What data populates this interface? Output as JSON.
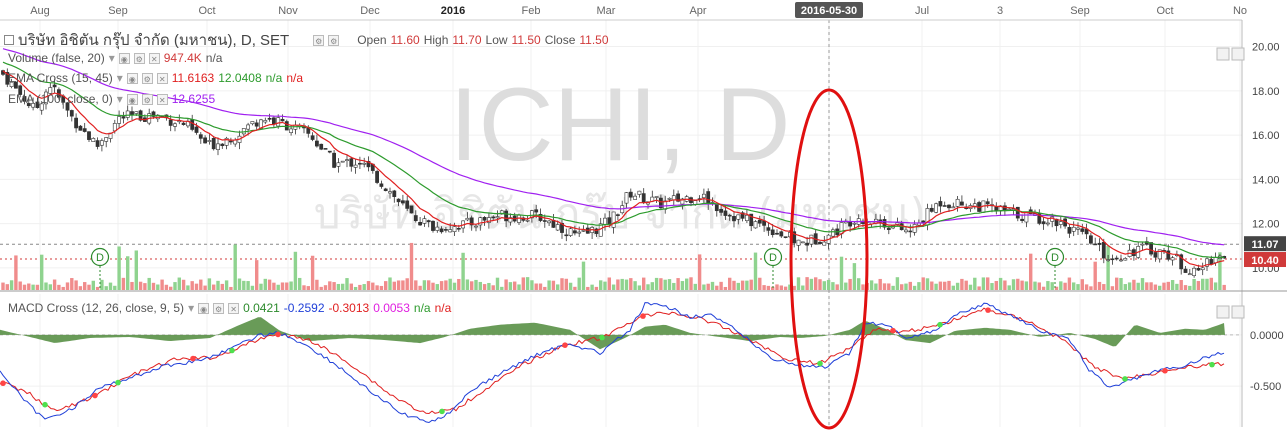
{
  "header": {
    "symbol": "บริษัท อิชิตัน กรุ๊ป จำกัด (มหาชน), D, SET",
    "ohlc": [
      {
        "label": "Open",
        "value": "11.60"
      },
      {
        "label": "High",
        "value": "11.70"
      },
      {
        "label": "Low",
        "value": "11.50"
      },
      {
        "label": "Close",
        "value": "11.50"
      }
    ],
    "watermark": "ICHI, D",
    "watermark_sub": "บริษัท อิชิตัน กรุ๊ป จำกัด (มหาชน)"
  },
  "indicators": {
    "volume": {
      "label": "Volume (false, 20)",
      "v1": "947.4K",
      "v2": "n/a"
    },
    "ema_cross": {
      "label": "EMA Cross (15, 45)",
      "v1": "11.6163",
      "v2": "12.0408",
      "v3": "n/a",
      "v4": "n/a"
    },
    "ema": {
      "label": "EMA (100, close, 0)",
      "v1": "12.6255"
    },
    "macd": {
      "label": "MACD Cross (12, 26, close, 9, 5)",
      "v1": "0.0421",
      "v2": "-0.2592",
      "v3": "-0.3013",
      "v4": "0.0053",
      "v5": "n/a",
      "v6": "n/a"
    }
  },
  "price_badges": {
    "upper": "11.07",
    "lower": "10.40"
  },
  "dividend_marker": "D",
  "crosshair_date": "2016-05-30",
  "colors": {
    "up": "#5aa55a",
    "down": "#c64545",
    "ema_fast": "#e02020",
    "ema_slow": "#2d9b2d",
    "ema100": "#a020f0",
    "macd_line": "#1f3fd8",
    "signal_line": "#e02020",
    "histogram": "#4f8a3b",
    "annotation": "#e01010",
    "badge_dark": "#444444",
    "badge_red": "#d03a3a"
  },
  "chart_data": [
    {
      "type": "candlestick",
      "title": "ICHI, D",
      "x_ticks": [
        "Aug",
        "Sep",
        "Oct",
        "Nov",
        "Dec",
        "2016",
        "Feb",
        "Mar",
        "Apr",
        "2016-05-30",
        "Jul",
        "3",
        "Sep",
        "Oct",
        "No"
      ],
      "ylim": [
        9.0,
        21.2
      ],
      "y_ticks": [
        "20.00",
        "18.00",
        "16.00",
        "14.00",
        "12.00",
        "10.00"
      ],
      "price_anchors": [
        {
          "x": 0,
          "close": 18.9
        },
        {
          "x": 35,
          "close": 17.1
        },
        {
          "x": 50,
          "close": 18.3
        },
        {
          "x": 70,
          "close": 16.9
        },
        {
          "x": 97,
          "close": 15.5
        },
        {
          "x": 120,
          "close": 16.8
        },
        {
          "x": 155,
          "close": 16.9
        },
        {
          "x": 185,
          "close": 16.5
        },
        {
          "x": 208,
          "close": 15.5
        },
        {
          "x": 235,
          "close": 16.0
        },
        {
          "x": 262,
          "close": 16.8
        },
        {
          "x": 285,
          "close": 16.5
        },
        {
          "x": 310,
          "close": 16.0
        },
        {
          "x": 335,
          "close": 14.7
        },
        {
          "x": 360,
          "close": 14.8
        },
        {
          "x": 385,
          "close": 13.7
        },
        {
          "x": 410,
          "close": 12.4
        },
        {
          "x": 435,
          "close": 11.8
        },
        {
          "x": 470,
          "close": 12.0
        },
        {
          "x": 500,
          "close": 12.4
        },
        {
          "x": 540,
          "close": 12.3
        },
        {
          "x": 580,
          "close": 11.4
        },
        {
          "x": 610,
          "close": 12.1
        },
        {
          "x": 630,
          "close": 13.4
        },
        {
          "x": 660,
          "close": 12.9
        },
        {
          "x": 700,
          "close": 13.3
        },
        {
          "x": 730,
          "close": 12.4
        },
        {
          "x": 770,
          "close": 11.8
        },
        {
          "x": 800,
          "close": 11.1
        },
        {
          "x": 830,
          "close": 11.5
        },
        {
          "x": 855,
          "close": 12.3
        },
        {
          "x": 880,
          "close": 12.1
        },
        {
          "x": 910,
          "close": 11.6
        },
        {
          "x": 940,
          "close": 13.0
        },
        {
          "x": 980,
          "close": 12.8
        },
        {
          "x": 1020,
          "close": 12.4
        },
        {
          "x": 1060,
          "close": 12.1
        },
        {
          "x": 1090,
          "close": 11.2
        },
        {
          "x": 1110,
          "close": 10.4
        },
        {
          "x": 1140,
          "close": 10.9
        },
        {
          "x": 1170,
          "close": 10.6
        },
        {
          "x": 1195,
          "close": 9.7
        },
        {
          "x": 1210,
          "close": 10.4
        },
        {
          "x": 1225,
          "close": 10.6
        }
      ],
      "dividend_x": [
        100,
        773,
        1055
      ],
      "series": [
        {
          "name": "EMA Cross (15, 45)"
        },
        {
          "name": "EMA (100, close, 0)"
        },
        {
          "name": "Volume (false, 20)"
        }
      ]
    },
    {
      "type": "line",
      "title": "MACD Cross (12, 26, close, 9, 5)",
      "ylim": [
        -0.9,
        0.4
      ],
      "y_ticks": [
        "0.0000",
        "-0.500"
      ],
      "series": [
        {
          "name": "MACD",
          "points": [
            {
              "x": 0,
              "y": -0.35
            },
            {
              "x": 25,
              "y": -0.65
            },
            {
              "x": 45,
              "y": -0.83
            },
            {
              "x": 75,
              "y": -0.7
            },
            {
              "x": 100,
              "y": -0.52
            },
            {
              "x": 130,
              "y": -0.42
            },
            {
              "x": 165,
              "y": -0.3
            },
            {
              "x": 200,
              "y": -0.25
            },
            {
              "x": 235,
              "y": -0.12
            },
            {
              "x": 260,
              "y": 0.0
            },
            {
              "x": 280,
              "y": 0.02
            },
            {
              "x": 310,
              "y": -0.12
            },
            {
              "x": 340,
              "y": -0.32
            },
            {
              "x": 370,
              "y": -0.55
            },
            {
              "x": 400,
              "y": -0.76
            },
            {
              "x": 425,
              "y": -0.85
            },
            {
              "x": 445,
              "y": -0.8
            },
            {
              "x": 470,
              "y": -0.55
            },
            {
              "x": 500,
              "y": -0.38
            },
            {
              "x": 535,
              "y": -0.2
            },
            {
              "x": 570,
              "y": -0.08
            },
            {
              "x": 600,
              "y": -0.18
            },
            {
              "x": 630,
              "y": 0.05
            },
            {
              "x": 645,
              "y": 0.3
            },
            {
              "x": 665,
              "y": 0.28
            },
            {
              "x": 690,
              "y": 0.18
            },
            {
              "x": 710,
              "y": 0.2
            },
            {
              "x": 740,
              "y": 0.02
            },
            {
              "x": 770,
              "y": -0.22
            },
            {
              "x": 800,
              "y": -0.3
            },
            {
              "x": 825,
              "y": -0.32
            },
            {
              "x": 850,
              "y": -0.18
            },
            {
              "x": 865,
              "y": 0.12
            },
            {
              "x": 885,
              "y": 0.1
            },
            {
              "x": 905,
              "y": -0.02
            },
            {
              "x": 930,
              "y": 0.02
            },
            {
              "x": 960,
              "y": 0.22
            },
            {
              "x": 985,
              "y": 0.3
            },
            {
              "x": 1010,
              "y": 0.2
            },
            {
              "x": 1040,
              "y": 0.04
            },
            {
              "x": 1070,
              "y": -0.05
            },
            {
              "x": 1090,
              "y": -0.35
            },
            {
              "x": 1110,
              "y": -0.52
            },
            {
              "x": 1135,
              "y": -0.42
            },
            {
              "x": 1160,
              "y": -0.35
            },
            {
              "x": 1185,
              "y": -0.3
            },
            {
              "x": 1205,
              "y": -0.22
            },
            {
              "x": 1225,
              "y": -0.17
            }
          ]
        },
        {
          "name": "Signal",
          "points": [
            {
              "x": 0,
              "y": -0.46
            },
            {
              "x": 30,
              "y": -0.58
            },
            {
              "x": 55,
              "y": -0.75
            },
            {
              "x": 90,
              "y": -0.62
            },
            {
              "x": 130,
              "y": -0.4
            },
            {
              "x": 175,
              "y": -0.24
            },
            {
              "x": 215,
              "y": -0.22
            },
            {
              "x": 250,
              "y": -0.08
            },
            {
              "x": 275,
              "y": 0.01
            },
            {
              "x": 310,
              "y": -0.05
            },
            {
              "x": 350,
              "y": -0.28
            },
            {
              "x": 390,
              "y": -0.58
            },
            {
              "x": 425,
              "y": -0.77
            },
            {
              "x": 455,
              "y": -0.73
            },
            {
              "x": 490,
              "y": -0.5
            },
            {
              "x": 525,
              "y": -0.28
            },
            {
              "x": 565,
              "y": -0.1
            },
            {
              "x": 605,
              "y": -0.02
            },
            {
              "x": 640,
              "y": 0.18
            },
            {
              "x": 670,
              "y": 0.22
            },
            {
              "x": 705,
              "y": 0.15
            },
            {
              "x": 745,
              "y": -0.02
            },
            {
              "x": 785,
              "y": -0.23
            },
            {
              "x": 820,
              "y": -0.28
            },
            {
              "x": 850,
              "y": -0.12
            },
            {
              "x": 875,
              "y": 0.06
            },
            {
              "x": 905,
              "y": 0.03
            },
            {
              "x": 940,
              "y": 0.1
            },
            {
              "x": 985,
              "y": 0.25
            },
            {
              "x": 1025,
              "y": 0.15
            },
            {
              "x": 1065,
              "y": -0.06
            },
            {
              "x": 1095,
              "y": -0.32
            },
            {
              "x": 1125,
              "y": -0.43
            },
            {
              "x": 1165,
              "y": -0.35
            },
            {
              "x": 1200,
              "y": -0.3
            },
            {
              "x": 1225,
              "y": -0.28
            }
          ]
        },
        {
          "name": "Histogram",
          "points": [
            {
              "x": 0,
              "y": 0.05
            },
            {
              "x": 30,
              "y": -0.02
            },
            {
              "x": 55,
              "y": -0.08
            },
            {
              "x": 90,
              "y": -0.03
            },
            {
              "x": 130,
              "y": -0.02
            },
            {
              "x": 170,
              "y": -0.06
            },
            {
              "x": 210,
              "y": -0.03
            },
            {
              "x": 240,
              "y": 0.1
            },
            {
              "x": 260,
              "y": 0.18
            },
            {
              "x": 280,
              "y": 0.04
            },
            {
              "x": 310,
              "y": -0.06
            },
            {
              "x": 350,
              "y": -0.03
            },
            {
              "x": 385,
              "y": -0.05
            },
            {
              "x": 420,
              "y": -0.08
            },
            {
              "x": 445,
              "y": -0.02
            },
            {
              "x": 470,
              "y": 0.06
            },
            {
              "x": 500,
              "y": 0.1
            },
            {
              "x": 535,
              "y": 0.12
            },
            {
              "x": 570,
              "y": 0.05
            },
            {
              "x": 600,
              "y": -0.14
            },
            {
              "x": 625,
              "y": -0.03
            },
            {
              "x": 645,
              "y": 0.08
            },
            {
              "x": 665,
              "y": 0.1
            },
            {
              "x": 690,
              "y": 0.02
            },
            {
              "x": 720,
              "y": -0.02
            },
            {
              "x": 750,
              "y": -0.06
            },
            {
              "x": 780,
              "y": -0.02
            },
            {
              "x": 800,
              "y": -0.03
            },
            {
              "x": 825,
              "y": -0.01
            },
            {
              "x": 850,
              "y": 0.05
            },
            {
              "x": 865,
              "y": 0.14
            },
            {
              "x": 885,
              "y": 0.06
            },
            {
              "x": 905,
              "y": -0.05
            },
            {
              "x": 930,
              "y": -0.08
            },
            {
              "x": 955,
              "y": 0.04
            },
            {
              "x": 985,
              "y": 0.07
            },
            {
              "x": 1010,
              "y": 0.05
            },
            {
              "x": 1040,
              "y": -0.02
            },
            {
              "x": 1070,
              "y": 0.02
            },
            {
              "x": 1095,
              "y": -0.04
            },
            {
              "x": 1115,
              "y": -0.12
            },
            {
              "x": 1135,
              "y": 0.1
            },
            {
              "x": 1160,
              "y": 0.02
            },
            {
              "x": 1185,
              "y": 0.06
            },
            {
              "x": 1205,
              "y": 0.05
            },
            {
              "x": 1225,
              "y": 0.12
            }
          ]
        }
      ]
    }
  ]
}
